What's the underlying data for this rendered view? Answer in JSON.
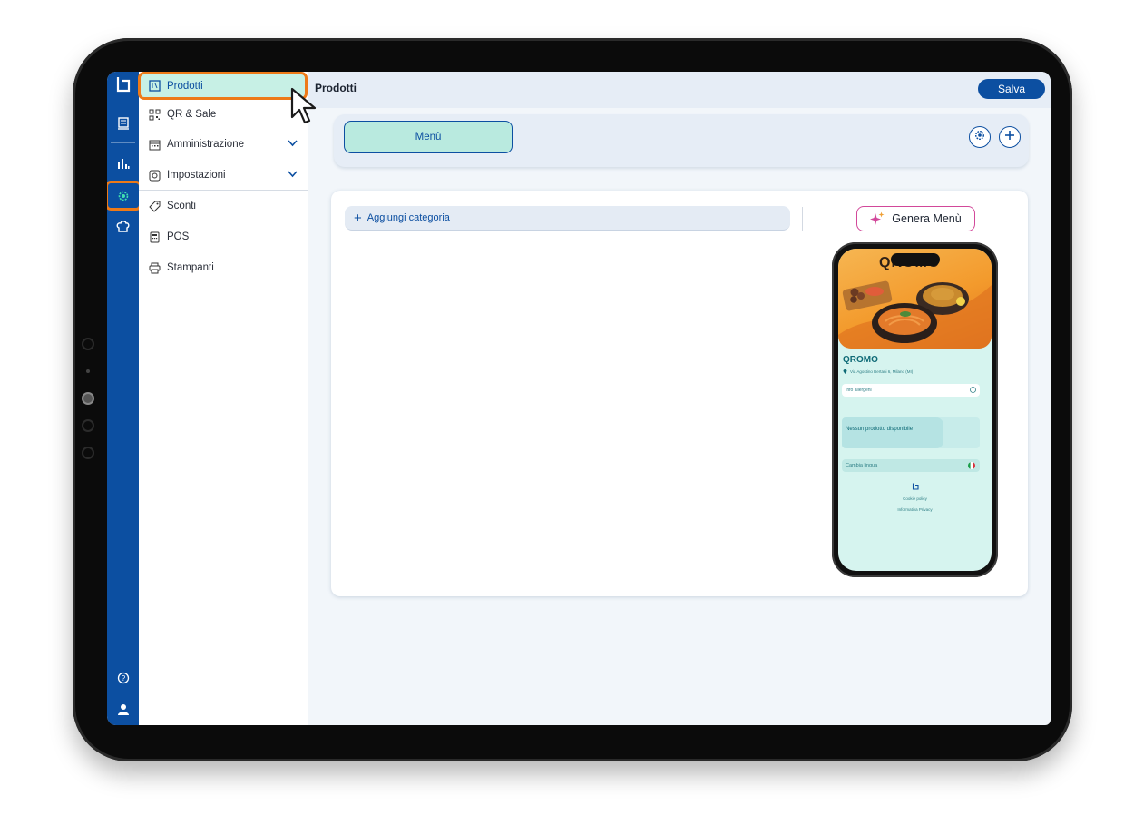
{
  "app": {
    "title": "Prodotti"
  },
  "sidebar": {
    "items": [
      {
        "label": "Prodotti",
        "icon": "menu-book-icon"
      },
      {
        "label": "QR & Sale",
        "icon": "qr-code-icon"
      },
      {
        "label": "Amministrazione",
        "icon": "calendar-icon",
        "expandable": true
      },
      {
        "label": "Impostazioni",
        "icon": "settings-box-icon",
        "expandable": true
      },
      {
        "label": "Sconti",
        "icon": "tag-icon"
      },
      {
        "label": "POS",
        "icon": "pos-terminal-icon"
      },
      {
        "label": "Stampanti",
        "icon": "printer-icon"
      }
    ],
    "active_index": 0
  },
  "rail": {
    "icons": [
      "logo-icon",
      "receipt-icon",
      "chart-icon",
      "gear-icon",
      "chef-hat-icon",
      "help-icon",
      "user-icon"
    ],
    "active": "gear-icon"
  },
  "header": {
    "title": "Prodotti",
    "save_label": "Salva"
  },
  "menu_bar": {
    "tab_label": "Menù"
  },
  "card": {
    "add_category_label": "Aggiungi categoria",
    "generate_label": "Genera Menù"
  },
  "preview": {
    "brand": "QROMO",
    "restaurant_name": "QROMO",
    "address": "Via Agostino Bertani 6, Milano (MI)",
    "allergens": "Info allergeni",
    "empty_message": "Nessun prodotto disponibile",
    "language_label": "Cambia lingua",
    "cookie_policy": "Cookie policy",
    "privacy": "Informativa Privacy"
  },
  "colors": {
    "brand_blue": "#0c4fa1",
    "accent_mint": "#c7f0e5",
    "highlight_orange": "#ee7a18",
    "ai_pink": "#d2489a"
  }
}
